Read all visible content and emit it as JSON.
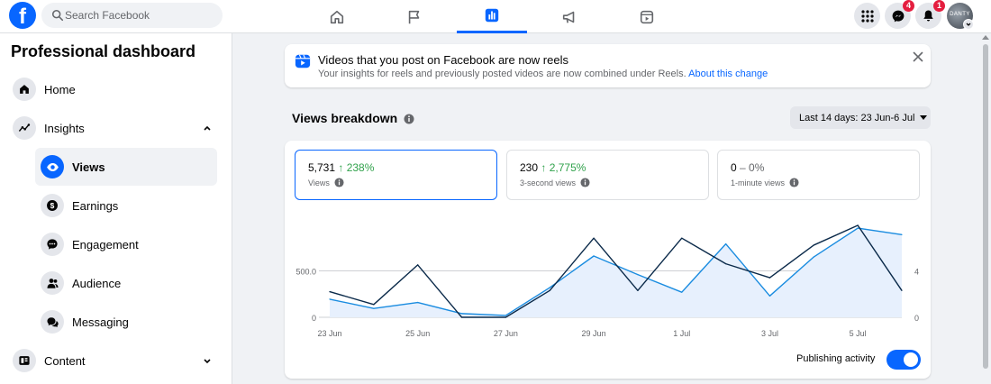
{
  "topbar": {
    "search_placeholder": "Search Facebook",
    "messenger_badge": "4",
    "notifications_badge": "1",
    "avatar_text": "DANTY",
    "accent": "#0866ff"
  },
  "sidebar": {
    "title": "Professional dashboard",
    "items": [
      {
        "label": "Home",
        "icon": "home-icon"
      },
      {
        "label": "Insights",
        "icon": "insights-icon"
      },
      {
        "label": "Views",
        "icon": "eye-icon"
      },
      {
        "label": "Earnings",
        "icon": "dollar-icon"
      },
      {
        "label": "Engagement",
        "icon": "chat-bubble-icon"
      },
      {
        "label": "Audience",
        "icon": "people-icon"
      },
      {
        "label": "Messaging",
        "icon": "messages-icon"
      },
      {
        "label": "Content",
        "icon": "content-icon"
      }
    ]
  },
  "notice": {
    "title": "Videos that you post on Facebook are now reels",
    "body": "Your insights for reels and previously posted videos are now combined under Reels.",
    "link": "About this change"
  },
  "breakdown": {
    "title": "Views breakdown",
    "range": "Last 14 days: 23 Jun-6 Jul",
    "metrics": [
      {
        "value": "5,731",
        "change": "↑ 238%",
        "label": "Views"
      },
      {
        "value": "230",
        "change": "↑ 2,775%",
        "label": "3-second views"
      },
      {
        "value": "0",
        "change": "– 0%",
        "label": "1-minute views"
      }
    ],
    "publishing_label": "Publishing activity",
    "publishing_on": true
  },
  "chart_data": {
    "type": "line",
    "categories": [
      "23 Jun",
      "24 Jun",
      "25 Jun",
      "26 Jun",
      "27 Jun",
      "28 Jun",
      "29 Jun",
      "30 Jun",
      "1 Jul",
      "2 Jul",
      "3 Jul",
      "4 Jul",
      "5 Jul",
      "6 Jul"
    ],
    "tick_labels": [
      "23 Jun",
      "25 Jun",
      "27 Jun",
      "29 Jun",
      "1 Jul",
      "3 Jul",
      "5 Jul"
    ],
    "left_axis": {
      "ticks": [
        "0",
        "500.0"
      ],
      "ylim": [
        0,
        990
      ]
    },
    "right_axis": {
      "ticks": [
        "0",
        "4"
      ],
      "ylim": [
        0,
        7.9
      ]
    },
    "series": [
      {
        "name": "Views",
        "axis": "left",
        "color": "#1a8ce0",
        "fill": "#e7f0fd",
        "values": [
          195,
          95,
          160,
          40,
          20,
          320,
          660,
          460,
          270,
          790,
          230,
          650,
          960,
          890
        ]
      },
      {
        "name": "Publishing activity",
        "axis": "right",
        "color": "#0b2a4a",
        "values": [
          2.2,
          1.1,
          4.5,
          0,
          0,
          2.3,
          6.8,
          2.3,
          6.8,
          4.6,
          3.4,
          6.2,
          7.9,
          2.3
        ]
      }
    ],
    "grid": true,
    "legend": "none"
  }
}
